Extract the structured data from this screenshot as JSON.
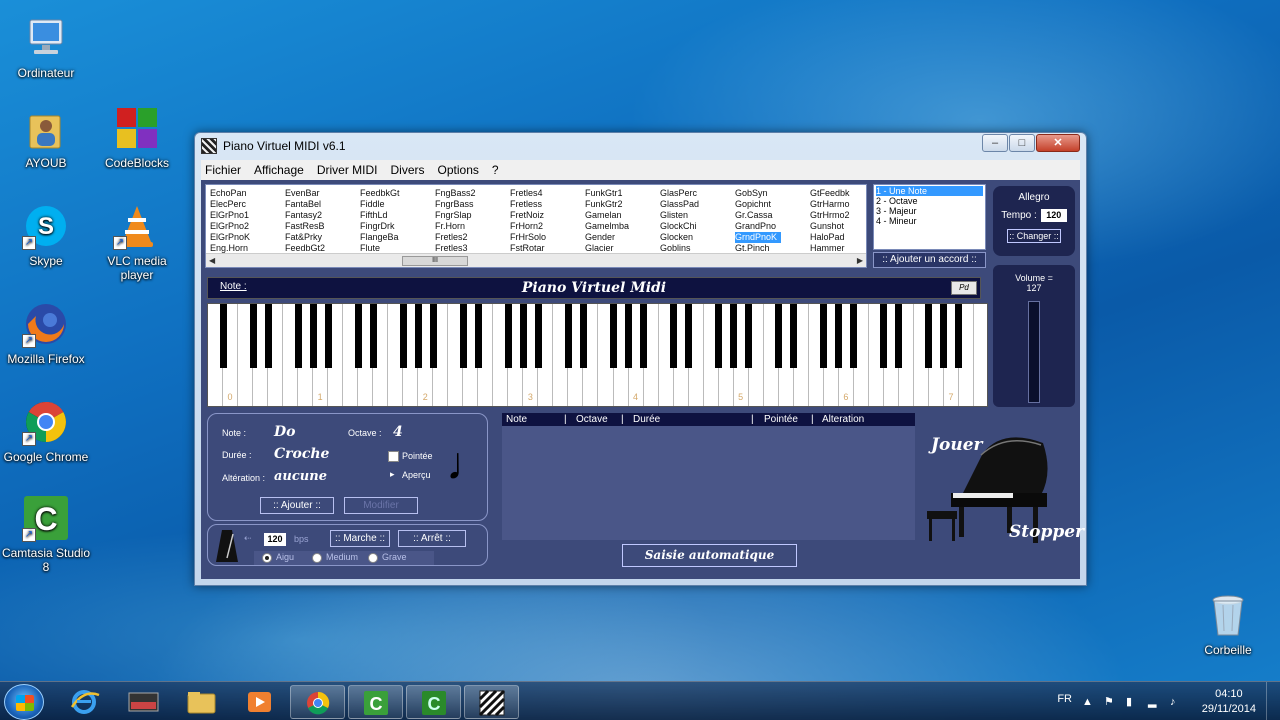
{
  "desktop": {
    "icons": [
      {
        "label": "Ordinateur",
        "icon": "computer-icon"
      },
      {
        "label": "AYOUB",
        "icon": "user-folder-icon"
      },
      {
        "label": "CodeBlocks",
        "icon": "codeblocks-icon"
      },
      {
        "label": "Skype",
        "icon": "skype-icon"
      },
      {
        "label": "VLC media player",
        "icon": "vlc-icon"
      },
      {
        "label": "Mozilla Firefox",
        "icon": "firefox-icon"
      },
      {
        "label": "Google Chrome",
        "icon": "chrome-icon"
      },
      {
        "label": "Camtasia Studio 8",
        "icon": "camtasia-icon"
      },
      {
        "label": "Corbeille",
        "icon": "recycle-bin-icon"
      }
    ]
  },
  "window": {
    "title": "Piano Virtuel MIDI v6.1",
    "controls": {
      "minimize": "–",
      "maximize": "□",
      "close": "✕"
    },
    "menu": [
      "Fichier",
      "Affichage",
      "Driver MIDI",
      "Divers",
      "Options",
      "?"
    ]
  },
  "instruments": {
    "columns": [
      [
        "EchoPan",
        "ElecPerc",
        "ElGrPno1",
        "ElGrPno2",
        "ElGrPnoK",
        "Eng.Horn"
      ],
      [
        "EvenBar",
        "FantaBel",
        "Fantasy2",
        "FastResB",
        "Fat&Prky",
        "FeedbGt2"
      ],
      [
        "FeedbkGt",
        "Fiddle",
        "FifthLd",
        "FingrDrk",
        "FlangeBa",
        "Flute"
      ],
      [
        "FngBass2",
        "FngrBass",
        "FngrSlap",
        "Fr.Horn",
        "Fretles2",
        "Fretles3"
      ],
      [
        "Fretles4",
        "Fretless",
        "FretNoiz",
        "FrHorn2",
        "FrHrSolo",
        "FstRotar"
      ],
      [
        "FunkGtr1",
        "FunkGtr2",
        "Gamelan",
        "Gamelmba",
        "Gender",
        "Glacier"
      ],
      [
        "GlasPerc",
        "GlassPad",
        "Glisten",
        "GlockChi",
        "Glocken",
        "Goblins"
      ],
      [
        "GobSyn",
        "Gopichnt",
        "Gr.Cassa",
        "GrandPno",
        "GrndPnoK",
        "Gt.Pinch"
      ],
      [
        "GtFeedbk",
        "GtrHarmo",
        "GtrHrmo2",
        "Gunshot",
        "HaloPad",
        "Hammer"
      ]
    ],
    "selected": "GrndPnoK",
    "scroll_thumb": "III"
  },
  "modes": {
    "items": [
      "1 - Une Note",
      "2 - Octave",
      "3 - Majeur",
      "4 - Mineur"
    ],
    "selected_index": 0,
    "add_chord": ":: Ajouter un accord ::"
  },
  "tempo": {
    "marking": "Allegro",
    "label": "Tempo :",
    "value": "120",
    "change_button": ":: Changer ::"
  },
  "keyboard_header": {
    "note_label": "Note :",
    "title": "Piano Virtuel Midi",
    "pd_button": "Pd"
  },
  "keyboard": {
    "octave_labels": [
      "0",
      "1",
      "2",
      "3",
      "4",
      "5",
      "6",
      "7"
    ],
    "white_key_count": 52
  },
  "volume": {
    "label": "Volume =",
    "value": "127"
  },
  "note_panel": {
    "note_label": "Note :",
    "note_value": "Do",
    "octave_label": "Octave :",
    "octave_value": "4",
    "duration_label": "Durée :",
    "duration_value": "Croche",
    "dotted_label": "Pointée",
    "dotted_checked": false,
    "preview_label": "Aperçu",
    "alteration_label": "Altération :",
    "alteration_value": "aucune",
    "add_button": ":: Ajouter ::",
    "modify_button": "Modifier",
    "note_glyph": "♩"
  },
  "metronome": {
    "bps_value": "120",
    "bps_unit": "bps",
    "start_button": ":: Marche ::",
    "stop_button": ":: Arrêt ::",
    "pitch_options": [
      "Aigu",
      "Medium",
      "Grave"
    ],
    "pitch_selected": "Aigu"
  },
  "sequence_table": {
    "columns": [
      "Note",
      "Octave",
      "Durée",
      "Pointée",
      "Alteration"
    ],
    "rows": []
  },
  "auto_input_button": "Saisie automatique",
  "playback": {
    "play_label": "Jouer",
    "stop_label": "Stopper"
  },
  "taskbar": {
    "apps": [
      "internet-explorer-icon",
      "piano-app-icon",
      "explorer-icon",
      "media-player-icon",
      "chrome-icon",
      "camtasia-icon",
      "camtasia-recorder-icon",
      "piano-virtuel-icon"
    ],
    "language": "FR",
    "time": "04:10",
    "date": "29/11/2014"
  },
  "colors": {
    "client_bg": "#3d4a7a",
    "dark_panel": "#1e2550",
    "header_bar": "#0e1240",
    "selection": "#3399ff"
  }
}
